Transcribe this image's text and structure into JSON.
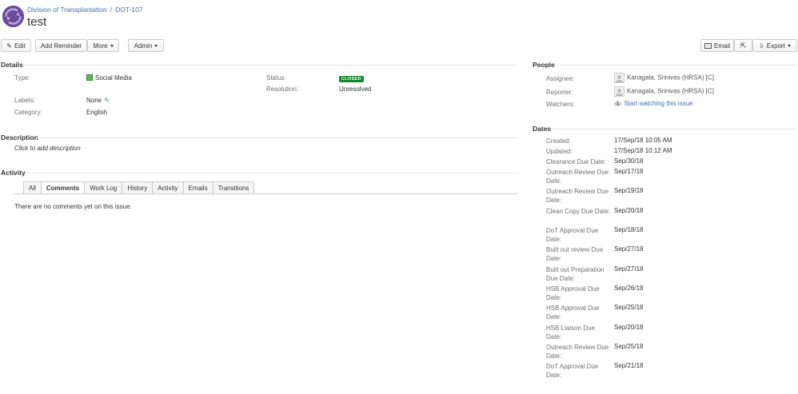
{
  "header": {
    "project": "Division of Transplantation",
    "separator": "/",
    "issue_key": "DOT-107",
    "title": "test"
  },
  "toolbar": {
    "edit": "Edit",
    "add_reminder": "Add Reminder",
    "more": "More",
    "admin": "Admin",
    "email": "Email",
    "export": "Export"
  },
  "details": {
    "title": "Details",
    "type_label": "Type:",
    "type_value": "Social Media",
    "status_label": "Status:",
    "status_value": "CLOSED",
    "resolution_label": "Resolution:",
    "resolution_value": "Unresolved",
    "labels_label": "Labels:",
    "labels_value": "None",
    "category_label": "Category:",
    "category_value": "English"
  },
  "description": {
    "title": "Description",
    "placeholder": "Click to add description"
  },
  "activity": {
    "title": "Activity",
    "tabs": [
      "All",
      "Comments",
      "Work Log",
      "History",
      "Activity",
      "Emails",
      "Transitions"
    ],
    "active_tab": "Comments",
    "empty_text": "There are no comments yet on this issue."
  },
  "people": {
    "title": "People",
    "assignee_label": "Assignee:",
    "assignee_value": "Kanagala, Srinivas (HRSA) [C]",
    "reporter_label": "Reporter:",
    "reporter_value": "Kanagala, Srinivas (HRSA) [C]",
    "watchers_label": "Watchers:",
    "watchers_count": "1",
    "watchers_link": "Start watching this issue"
  },
  "dates": {
    "title": "Dates",
    "items": [
      {
        "label": "Created:",
        "value": "17/Sep/18 10:05 AM"
      },
      {
        "label": "Updated:",
        "value": "17/Sep/18 10:12 AM"
      },
      {
        "label": "Clearance Due Date:",
        "value": "Sep/30/18"
      },
      {
        "label": "Outreach Review Due Date:",
        "value": "Sep/17/18"
      },
      {
        "label": "Outreach Review Due Date:",
        "value": "Sep/19/18"
      },
      {
        "label": "Clean Copy Due Date:",
        "value": "Sep/20/18"
      },
      {
        "label": "DoT Approval Due Date:",
        "value": "Sep/18/18"
      },
      {
        "label": "Built out review Due Date:",
        "value": "Sep/27/18"
      },
      {
        "label": "Built out Preparation Due Date:",
        "value": "Sep/27/18"
      },
      {
        "label": "HSB Approval Due Date:",
        "value": "Sep/26/18"
      },
      {
        "label": "HSB Approval Due Date:",
        "value": "Sep/25/18"
      },
      {
        "label": "HSB Liaison Due Date:",
        "value": "Sep/20/18"
      },
      {
        "label": "Outreach Review Due Date:",
        "value": "Sep/25/18"
      },
      {
        "label": "DoT Approval Due Date:",
        "value": "Sep/21/18"
      }
    ]
  },
  "colors": {
    "link": "#3b73af",
    "status_closed": "#14892c",
    "avatar": "#6a4a9c"
  }
}
